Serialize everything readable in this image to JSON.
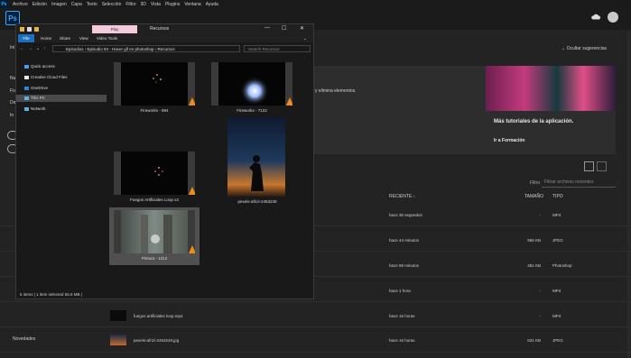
{
  "menubar": {
    "logo": "Ps",
    "items": [
      "Archivo",
      "Edición",
      "Imagen",
      "Capa",
      "Texto",
      "Selección",
      "Filtro",
      "3D",
      "Vista",
      "Plugins",
      "Ventana",
      "Ayuda"
    ]
  },
  "app": {
    "logo": "Ps",
    "suggestions_toggle": "Ocultar sugerencias"
  },
  "left": {
    "lbl1": "Ini",
    "lbl2": "Nu",
    "lbl3": "Fo",
    "lbl4": "Do",
    "lbl5": "In",
    "novedades": "Novedades"
  },
  "banner": {
    "description": "y elimina elementos.",
    "tutorial_title": "Más tutoriales de la aplicación.",
    "tutorial_link": "Ir a Formación"
  },
  "filter": {
    "label": "Filtro",
    "placeholder": "Filtrar archivos recientes"
  },
  "table": {
    "headers": {
      "recent": "RECIENTE ↓",
      "size": "TAMAÑO",
      "type": "TIPO"
    },
    "rows": [
      {
        "name": "",
        "recent": "hace 30 segundos",
        "size": "-",
        "type": "MP4"
      },
      {
        "name": "",
        "recent": "hace 44 minutos",
        "size": "965 KB",
        "type": "JPEG"
      },
      {
        "name": "",
        "recent": "hace 59 minutos",
        "size": "481 KB",
        "type": "Photoshop"
      },
      {
        "name": "",
        "recent": "hace 1 hora",
        "size": "-",
        "type": "MP4"
      },
      {
        "name": "fuegos artificiales loop.mp4",
        "recent": "hace 16 horas",
        "size": "-",
        "type": "MP4"
      },
      {
        "name": "pexels-afrizi-2453249.jpg",
        "recent": "hace 16 horas",
        "size": "631 KB",
        "type": "JPEG"
      }
    ]
  },
  "explorer": {
    "play_tab": "Play",
    "title": "Recursos",
    "window_controls": {
      "minimize": "—",
      "maximize": "☐",
      "close": "✕"
    },
    "ribbon": {
      "file": "File",
      "home": "Home",
      "share": "Share",
      "view": "View",
      "video_tools": "Video Tools"
    },
    "path": "Episodios  ›  Episodio 94 - Hacer gif en photoshop  ›  Recursos",
    "search_placeholder": "Search Recursos",
    "nav": [
      "Quick access",
      "Creative Cloud Files",
      "OneDrive",
      "This PC",
      "Network"
    ],
    "files": [
      {
        "caption": "Fireworks - 894"
      },
      {
        "caption": "Fireworks - 7122"
      },
      {
        "caption": "Fuegos Artificiales Loop x3"
      },
      {
        "caption": "pexels-afrizi-2453249"
      },
      {
        "caption": "Pintura - 1312"
      }
    ],
    "status": "5 items  |  1 item selected  55.6 MB  |"
  },
  "colors": {
    "accent": "#31a8ff",
    "file_tab": "#1a6fbf",
    "play_tab": "#f5c9dc",
    "vlc": "#f08c1a"
  }
}
